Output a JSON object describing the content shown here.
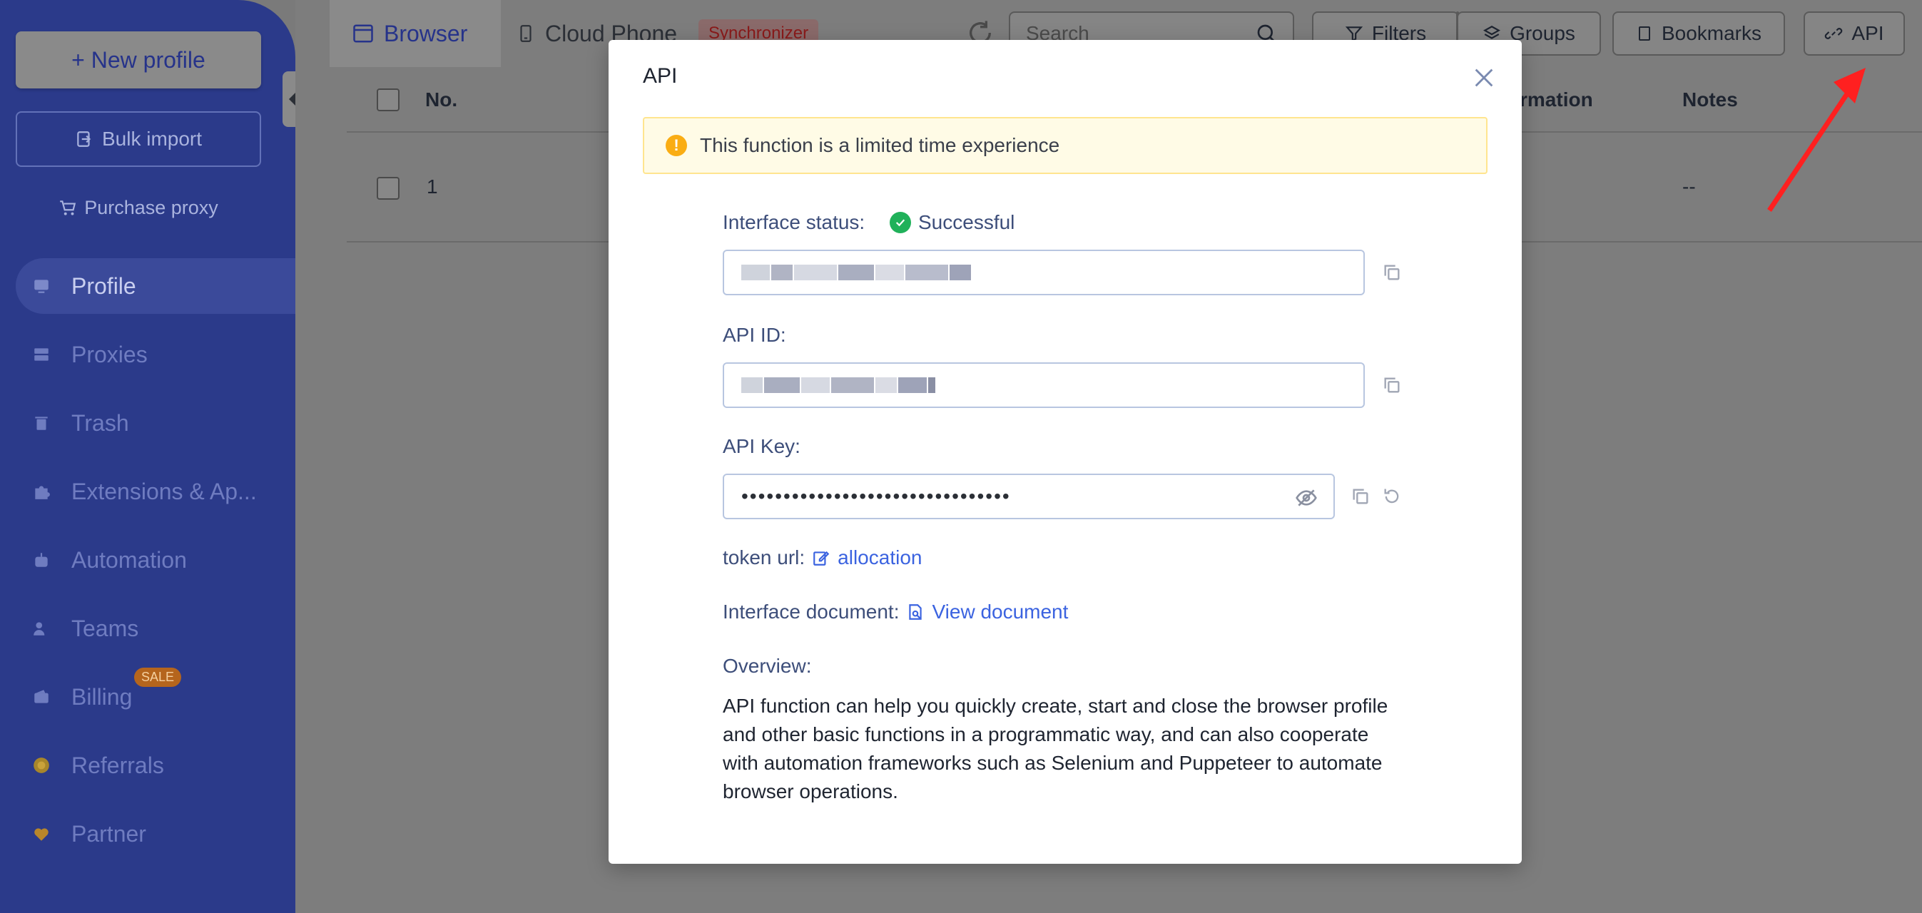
{
  "sidebar": {
    "new_profile": "+ New profile",
    "bulk_import": "Bulk import",
    "purchase_proxy": "Purchase proxy",
    "items": [
      {
        "label": "Profile",
        "icon": "profile-icon"
      },
      {
        "label": "Proxies",
        "icon": "proxies-icon"
      },
      {
        "label": "Trash",
        "icon": "trash-icon"
      },
      {
        "label": "Extensions & Ap...",
        "icon": "puzzle-icon"
      },
      {
        "label": "Automation",
        "icon": "robot-icon"
      },
      {
        "label": "Teams",
        "icon": "users-icon"
      },
      {
        "label": "Billing",
        "icon": "wallet-icon"
      },
      {
        "label": "Referrals",
        "icon": "coin-icon"
      },
      {
        "label": "Partner",
        "icon": "heart-icon"
      }
    ],
    "sale_badge": "SALE"
  },
  "topbar": {
    "tab_browser": "Browser",
    "tab_cloud": "Cloud Phone",
    "sync_badge": "Synchronizer",
    "search_placeholder": "Search",
    "filters": "Filters",
    "groups": "Groups",
    "bookmarks": "Bookmarks",
    "api": "API"
  },
  "table": {
    "col_no": "No.",
    "col_info": "rmation",
    "col_notes": "Notes",
    "row_no": "1",
    "row_notes": "--"
  },
  "modal": {
    "title": "API",
    "notice": "This function is a limited time experience",
    "interface_status_label": "Interface status:",
    "interface_status_value": "Successful",
    "api_id_label": "API ID:",
    "api_key_label": "API Key:",
    "api_key_value": "••••••••••••••••••••••••••••••••",
    "token_url_label": "token url:",
    "token_url_link": "allocation",
    "interface_doc_label": "Interface document:",
    "interface_doc_link": "View document",
    "overview_label": "Overview:",
    "overview_text": "API function can help you quickly create, start and close the browser profile and other basic functions in a programmatic way, and can also cooperate with automation frameworks such as Selenium and Puppeteer to automate browser operations."
  },
  "colors": {
    "sidebar_bg": "#2b3a8a",
    "accent_link": "#3b63e0",
    "success": "#20b15a",
    "warning": "#faad14",
    "annotation_arrow": "#ff2020"
  }
}
